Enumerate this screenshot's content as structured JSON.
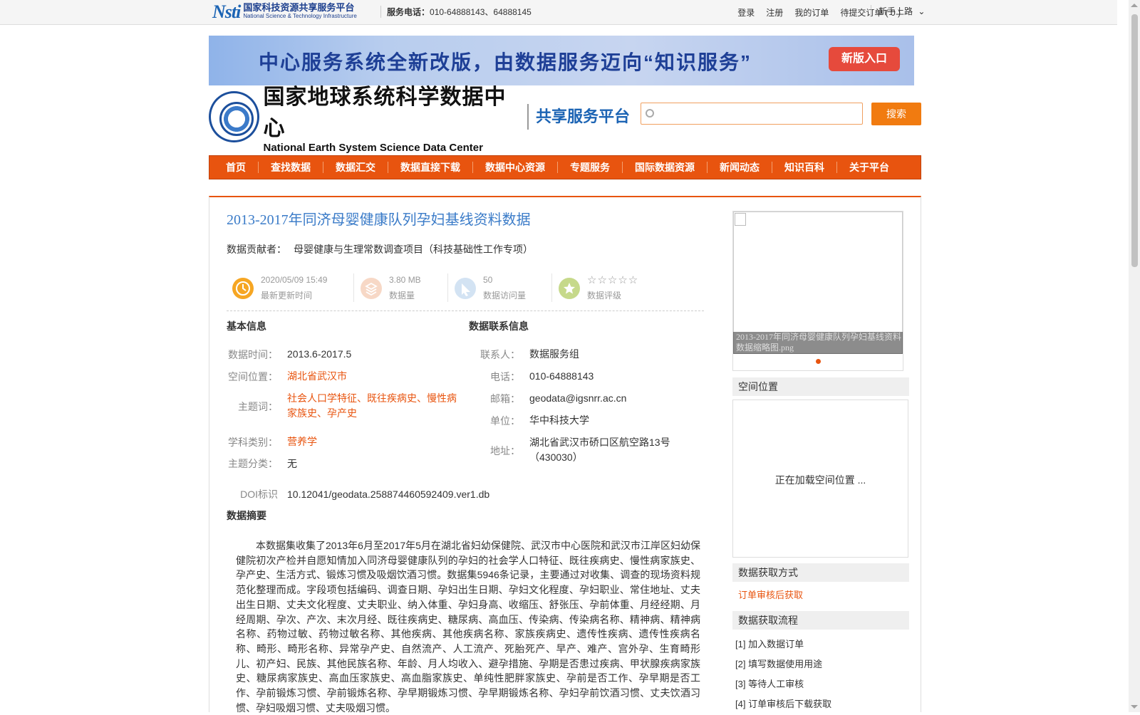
{
  "topbar": {
    "logo_mark": "Nsti",
    "logo_cn": "国家科技资源共享服务平台",
    "logo_en": "National Science & Technology Infrastructure",
    "phone_label": "服务电话：",
    "phone_numbers": "010-64888143、64888145",
    "links": [
      "登录",
      "注册",
      "我的订单",
      "待提交订单 ( 0 )"
    ],
    "newbie": "新手上路"
  },
  "banner": {
    "text": "中心服务系统全新改版，由数据服务迈向“知识服务”",
    "button": "新版入口"
  },
  "header": {
    "center_cn": "国家地球系统科学数据中心",
    "center_en": "National Earth System Science Data Center",
    "share_platform": "共享服务平台",
    "search_placeholder": "",
    "search_button": "搜索"
  },
  "nav": [
    "首页",
    "查找数据",
    "数据汇交",
    "数据直接下载",
    "数据中心资源",
    "专题服务",
    "国际数据资源",
    "新闻动态",
    "知识百科",
    "关于平台"
  ],
  "dataset": {
    "title": "2013-2017年同济母婴健康队列孕妇基线资料数据",
    "contributor_label": "数据贡献者：",
    "contributor": "母婴健康与生理常数调查项目（科技基础性工作专项）",
    "stats": {
      "updated_value": "2020/05/09 15:49",
      "updated_label": "最新更新时间",
      "size_value": "3.80 MB",
      "size_label": "数据量",
      "visits_value": "50",
      "visits_label": "数据访问量",
      "rating_stars": "☆☆☆☆☆",
      "rating_label": "数据评级"
    },
    "basic": {
      "title": "基本信息",
      "time_label": "数据时间：",
      "time": "2013.6-2017.5",
      "location_label": "空间位置：",
      "location": "湖北省武汉市",
      "keywords_label": "主题词：",
      "keywords_line1": "社会人口学特征、既往疾病史、慢性病",
      "keywords_line2": "家族史、孕产史",
      "discipline_label": "学科类别：",
      "discipline": "营养学",
      "category_label": "主题分类：",
      "category": "无",
      "doi_label": "DOI标识",
      "doi": "10.12041/geodata.258874460592409.ver1.db"
    },
    "contact": {
      "title": "数据联系信息",
      "person_label": "联系人：",
      "person": "数据服务组",
      "phone_label": "电话：",
      "phone": "010-64888143",
      "email_label": "邮箱：",
      "email": "geodata@igsnrr.ac.cn",
      "unit_label": "单位：",
      "unit": "华中科技大学",
      "address_label": "地址：",
      "address_line1": "湖北省武汉市硚口区航空路13号",
      "address_line2": "（430030）"
    },
    "abstract_title": "数据摘要",
    "abstract": "本数据集收集了2013年6月至2017年5月在湖北省妇幼保健院、武汉市中心医院和武汉市江岸区妇幼保健院初次产检并自愿知情加入同济母婴健康队列的孕妇的社会学人口特征、既往疾病史、慢性病家族史、孕产史、生活方式、锻炼习惯及吸烟饮酒习惯。数据集5946条记录，主要通过对收集、调查的现场资料规范化整理而成。字段项包括编码、调查日期、孕妇出生日期、孕妇文化程度、孕妇职业、常住地址、丈夫出生日期、丈夫文化程度、丈夫职业、纳入体重、孕妇身高、收缩压、舒张压、孕前体重、月经经期、月经周期、孕次、产次、末次月经、既往疾病史、糖尿病、高血压、传染病、传染病名称、精神病、精神病名称、药物过敏、药物过敏名称、其他疾病、其他疾病名称、家族疾病史、遗传性疾病、遗传性疾病名称、畸形、畸形名称、异常孕产史、自然流产、人工流产、死胎死产、早产、难产、宫外孕、生育畸形儿、初产妇、民族、其他民族名称、年龄、月人均收入、避孕措施、孕期是否患过疾病、甲状腺疾病家族史、糖尿病家族史、高血压家族史、高血脂家族史、单纯性肥胖家族史、孕前是否工作、孕早期是否工作、孕前锻炼习惯、孕前锻炼名称、孕早期锻炼习惯、孕早期锻炼名称、孕妇孕前饮酒习惯、丈夫饮酒习惯、孕妇吸烟习惯、丈夫吸烟习惯。"
  },
  "sidebar": {
    "thumb_caption": "2013-2017年同济母婴健康队列孕妇基线资料数据缩略图.png",
    "location_title": "空间位置",
    "map_loading": "正在加载空间位置 ...",
    "access_title": "数据获取方式",
    "access_link": "订单审核后获取",
    "process_title": "数据获取流程",
    "steps": [
      "[1] 加入数据订单",
      "[2] 填写数据使用用途",
      "[3] 等待人工审核",
      "[4] 订单审核后下载获取"
    ]
  },
  "colors": {
    "accent": "#e8540f",
    "title_blue": "#3a7bc8",
    "search_orange": "#f17b10"
  }
}
